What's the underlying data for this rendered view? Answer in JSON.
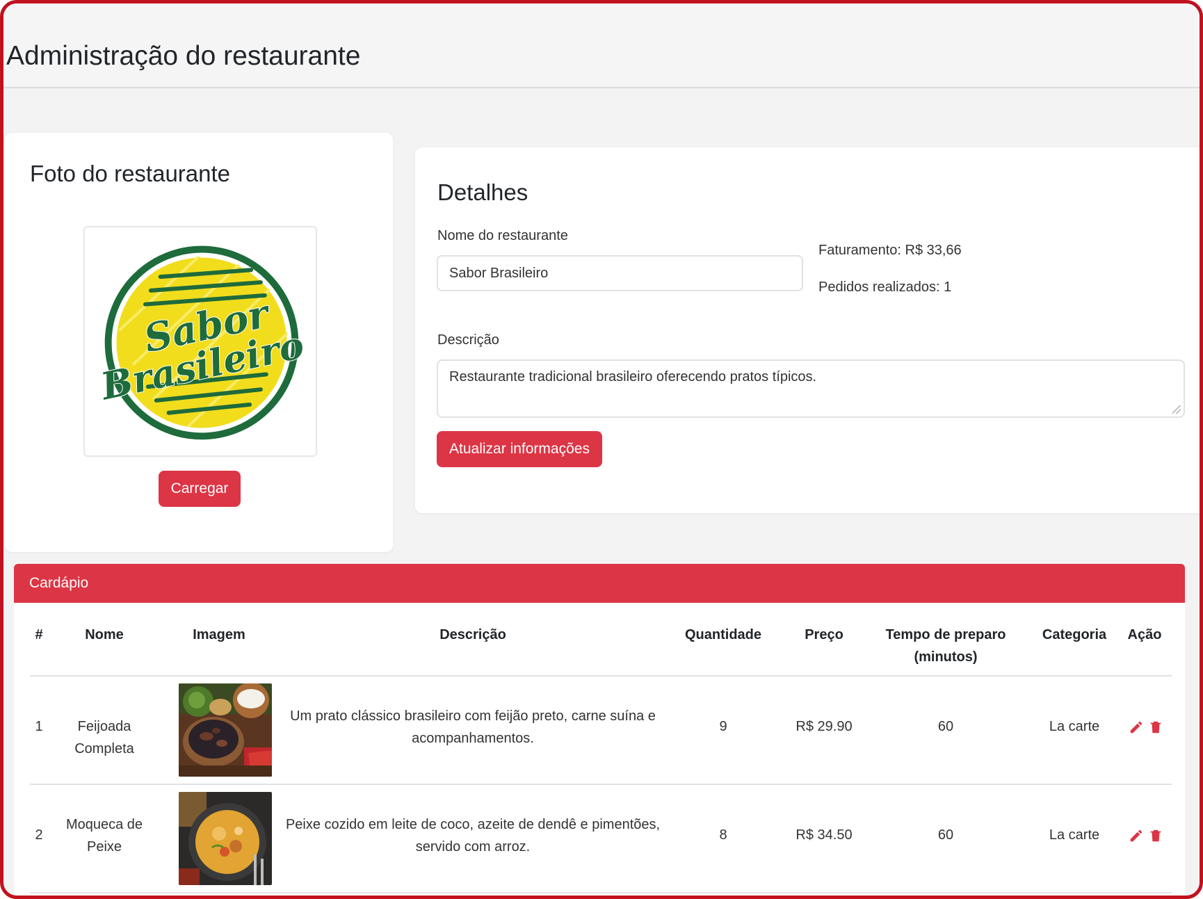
{
  "page": {
    "title": "Administração do restaurante"
  },
  "photo_card": {
    "title": "Foto do restaurante",
    "logo_line1": "Sabor",
    "logo_line2": "Brasileiro",
    "upload_button": "Carregar"
  },
  "details": {
    "title": "Detalhes",
    "name_label": "Nome do restaurante",
    "name_value": "Sabor Brasileiro",
    "revenue": "Faturamento: R$ 33,66",
    "orders": "Pedidos realizados: 1",
    "description_label": "Descrição",
    "description_value": "Restaurante tradicional brasileiro oferecendo pratos típicos.",
    "update_button": "Atualizar informações"
  },
  "menu": {
    "header": "Cardápio",
    "columns": {
      "index": "#",
      "name": "Nome",
      "image": "Imagem",
      "description": "Descrição",
      "quantity": "Quantidade",
      "price": "Preço",
      "prep_time": "Tempo de preparo (minutos)",
      "category": "Categoria",
      "action": "Ação"
    },
    "rows": [
      {
        "index": "1",
        "name": "Feijoada Completa",
        "image": "feijoada-photo",
        "description": "Um prato clássico brasileiro com feijão preto, carne suína e acompanhamentos.",
        "quantity": "9",
        "price": "R$ 29.90",
        "prep_time": "60",
        "category": "La carte"
      },
      {
        "index": "2",
        "name": "Moqueca de Peixe",
        "image": "moqueca-photo",
        "description": "Peixe cozido em leite de coco, azeite de dendê e pimentões, servido com arroz.",
        "quantity": "8",
        "price": "R$ 34.50",
        "prep_time": "60",
        "category": "La carte"
      }
    ]
  },
  "colors": {
    "accent": "#dc3545",
    "frame": "#c1121f",
    "logo_green": "#1e6b3c",
    "logo_yellow": "#f2dd1c"
  }
}
